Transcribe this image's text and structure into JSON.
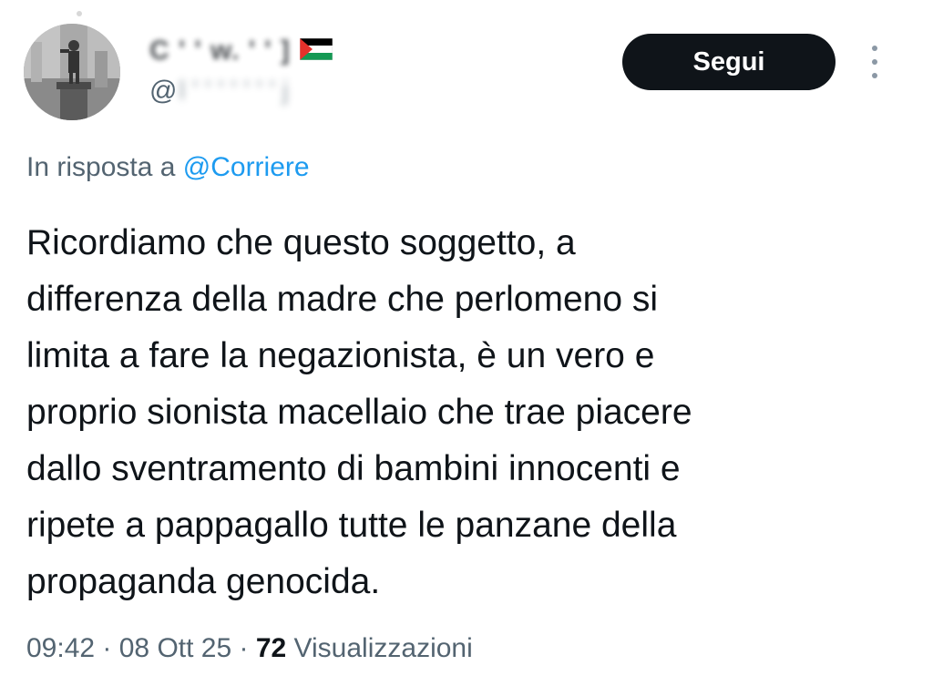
{
  "author": {
    "display_name": "C  ' ' w. ' ' ]",
    "flag_icon": "palestine-flag-icon",
    "handle_prefix": "@",
    "handle_redacted": "l ' ' ' ' ' ' ' j"
  },
  "follow_button": {
    "label": "Segui"
  },
  "more_icon": "vertical-ellipsis-icon",
  "reply": {
    "prefix": "In risposta a ",
    "mention": "@Corriere"
  },
  "tweet": {
    "lines": [
      "Ricordiamo che questo soggetto, a",
      "differenza della madre che perlomeno si",
      "limita a fare la negazionista, è un vero e",
      "proprio sionista macellaio che trae piacere",
      "dallo sventramento di bambini innocenti e",
      "ripete a pappagallo tutte le panzane della",
      "propaganda genocida."
    ]
  },
  "meta": {
    "time": "09:42",
    "separator_1": " · ",
    "date": "08 Ott 25",
    "separator_2": " · ",
    "views_count": "72",
    "views_label": " Visualizzazioni"
  },
  "colors": {
    "text_primary": "#0f1419",
    "text_secondary": "#536471",
    "link": "#1d9bf0",
    "button_bg": "#0f1419",
    "button_text": "#ffffff"
  }
}
